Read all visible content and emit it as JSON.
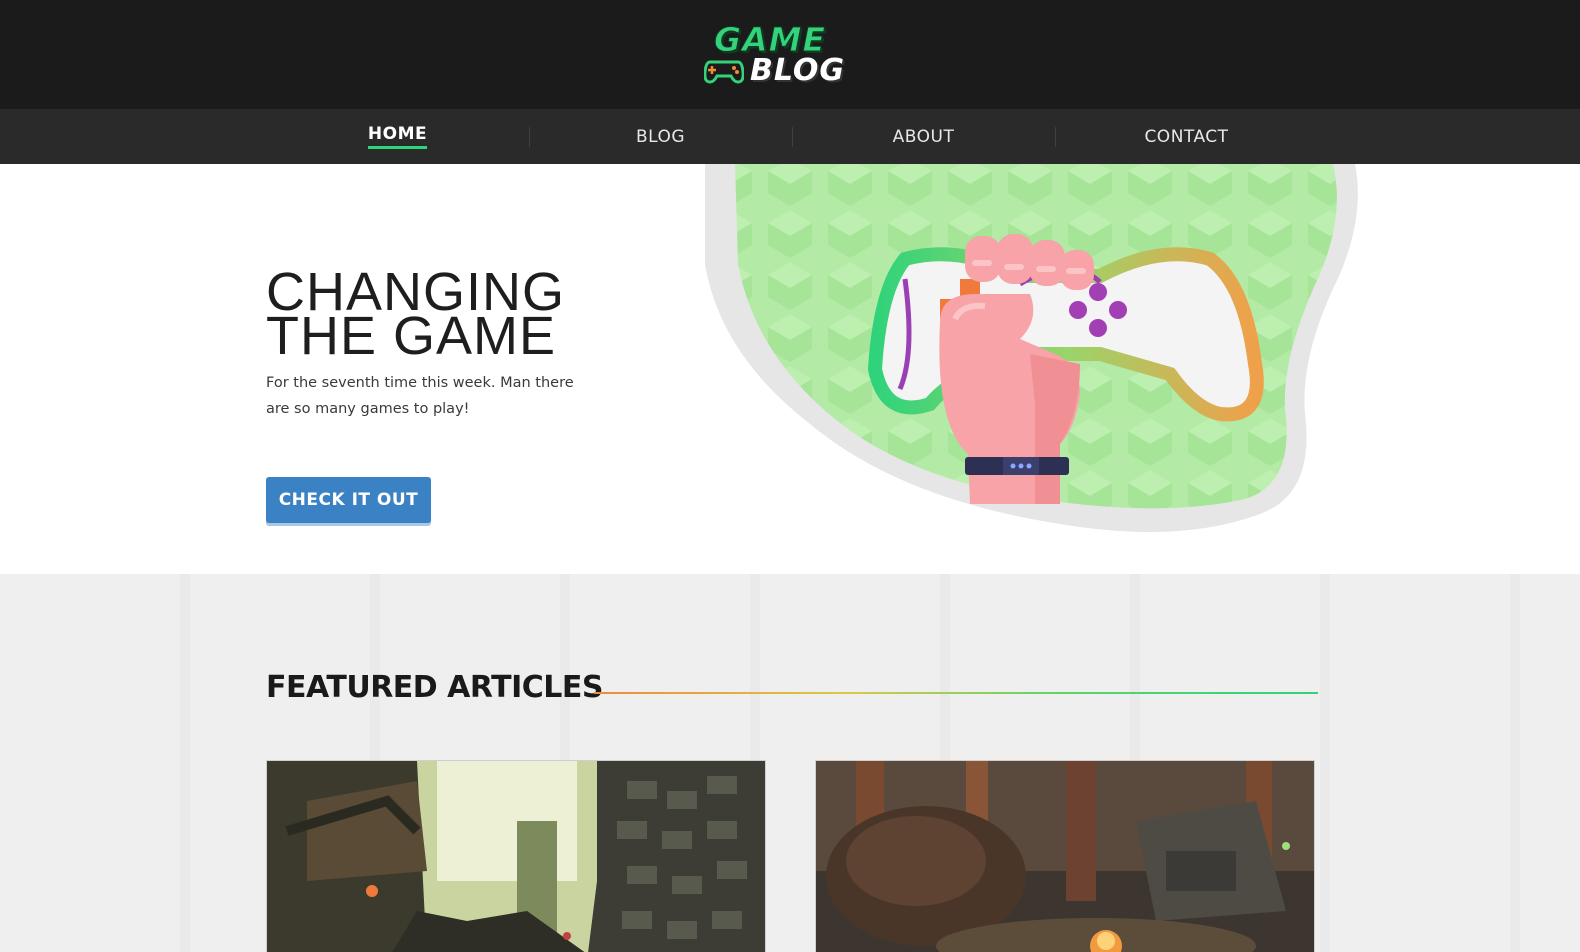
{
  "header": {
    "logo": {
      "line1": "GAME",
      "line2": "BLOG"
    }
  },
  "nav": {
    "items": [
      {
        "label": "HOME",
        "active": true
      },
      {
        "label": "BLOG",
        "active": false
      },
      {
        "label": "ABOUT",
        "active": false
      },
      {
        "label": "CONTACT",
        "active": false
      }
    ]
  },
  "hero": {
    "title_line1": "CHANGING",
    "title_line2": "THE GAME",
    "subtitle": "For the seventh time this week. Man there are so many games to play!",
    "cta_label": "CHECK IT OUT",
    "illustration": "fist-holding-gamepad-illustration"
  },
  "featured": {
    "title": "FEATURED ARTICLES",
    "articles": [
      {
        "image": "medieval-village-screenshot"
      },
      {
        "image": "forest-campfire-screenshot"
      }
    ]
  },
  "colors": {
    "header_bg": "#1b1b1b",
    "nav_bg": "#2a2a2a",
    "accent_green": "#2fd37b",
    "accent_orange": "#f08a3c",
    "cta_blue": "#3b82c4",
    "featured_bg": "#efefef"
  }
}
